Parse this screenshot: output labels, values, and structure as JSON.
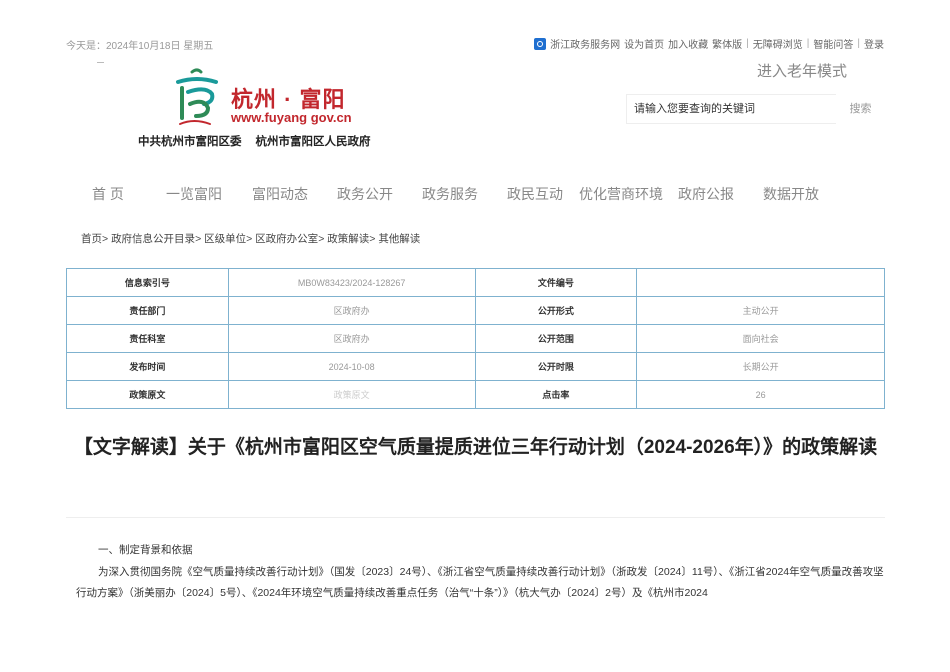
{
  "topbar": {
    "date": "今天是：2024年10月18日 星期五",
    "links": [
      "浙江政务服务网",
      "设为首页",
      "加入收藏",
      "繁体版",
      "无障碍浏览",
      "智能问答",
      "登录"
    ]
  },
  "header": {
    "logo_title": "杭州 · 富阳",
    "logo_url": "www.fuyang gov.cn",
    "org_left": "中共杭州市富阳区委",
    "org_right": "杭州市富阳区人民政府",
    "elder_mode": "进入老年模式",
    "search_placeholder": "请输入您要查询的关键词",
    "search_button": "搜索"
  },
  "nav": [
    "首 页",
    "一览富阳",
    "富阳动态",
    "政务公开",
    "政务服务",
    "政民互动",
    "优化营商环境",
    "政府公报",
    "数据开放"
  ],
  "breadcrumb": [
    "首页",
    "政府信息公开目录",
    "区级单位",
    "区政府办公室",
    "政策解读",
    "其他解读"
  ],
  "meta_table": [
    [
      "信息索引号",
      "MB0W83423/2024-128267",
      "文件编号",
      ""
    ],
    [
      "责任部门",
      "区政府办",
      "公开形式",
      "主动公开"
    ],
    [
      "责任科室",
      "区政府办",
      "公开范围",
      "面向社会"
    ],
    [
      "发布时间",
      "2024-10-08",
      "公开时限",
      "长期公开"
    ],
    [
      "政策原文",
      "政策原文",
      "点击率",
      "26"
    ]
  ],
  "article": {
    "title": "【文字解读】关于《杭州市富阳区空气质量提质进位三年行动计划（2024-2026年）》的政策解读",
    "section1": "一、制定背景和依据",
    "para1": "为深入贯彻国务院《空气质量持续改善行动计划》（国发〔2023〕24号）、《浙江省空气质量持续改善行动计划》（浙政发〔2024〕11号）、《浙江省2024年空气质量改善攻坚行动方案》（浙美丽办〔2024〕5号）、《2024年环境空气质量持续改善重点任务（治气“十条”）》（杭大气办〔2024〕2号）及《杭州市2024"
  },
  "colors": {
    "brand_red": "#c2272d",
    "table_border": "#7fb2cf",
    "gov_blue": "#1f6fd0"
  },
  "icons": [
    "gov-service-icon",
    "logo-mark"
  ]
}
